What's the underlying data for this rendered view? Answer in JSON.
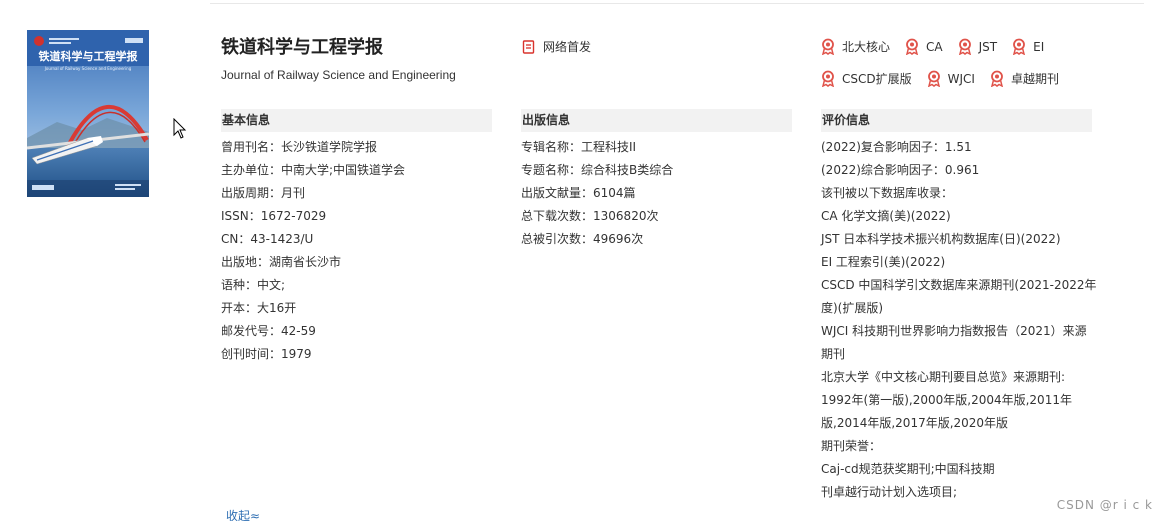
{
  "journal": {
    "title": "铁道科学与工程学报",
    "english_title": "Journal of Railway Science and Engineering",
    "network_first": "网络首发"
  },
  "badges_row1": [
    "北大核心",
    "CA",
    "JST",
    "EI"
  ],
  "badges_row2": [
    "CSCD扩展版",
    "WJCI",
    "卓越期刊"
  ],
  "basic": {
    "heading": "基本信息",
    "rows": [
      {
        "label": "曾用刊名：",
        "value": "长沙铁道学院学报"
      },
      {
        "label": "主办单位：",
        "value": "中南大学;中国铁道学会"
      },
      {
        "label": "出版周期：",
        "value": "月刊"
      },
      {
        "label": "ISSN：",
        "value": "1672-7029"
      },
      {
        "label": "CN：",
        "value": "43-1423/U"
      },
      {
        "label": "出版地：",
        "value": "湖南省长沙市"
      },
      {
        "label": "语种：",
        "value": "中文;"
      },
      {
        "label": "开本：",
        "value": "大16开"
      },
      {
        "label": "邮发代号：",
        "value": "42-59"
      },
      {
        "label": "创刊时间：",
        "value": "1979"
      }
    ]
  },
  "publish": {
    "heading": "出版信息",
    "rows": [
      {
        "label": "专辑名称：",
        "value": "工程科技II"
      },
      {
        "label": "专题名称：",
        "value": "综合科技B类综合"
      },
      {
        "label": "出版文献量：",
        "value": "6104篇"
      },
      {
        "label": "总下载次数：",
        "value": "1306820次"
      },
      {
        "label": "总被引次数：",
        "value": "49696次"
      }
    ]
  },
  "evaluation": {
    "heading": "评价信息",
    "lines": [
      "(2022)复合影响因子：1.51",
      "(2022)综合影响因子：0.961",
      "该刊被以下数据库收录：",
      "CA 化学文摘(美)(2022)",
      "JST 日本科学技术振兴机构数据库(日)(2022)",
      "EI 工程索引(美)(2022)",
      "CSCD 中国科学引文数据库来源期刊(2021-2022年",
      "度)(扩展版)",
      "WJCI 科技期刊世界影响力指数报告（2021）来源",
      "期刊",
      "北京大学《中文核心期刊要目总览》来源期刊:",
      "1992年(第一版),2000年版,2004年版,2011年",
      "版,2014年版,2017年版,2020年版",
      "期刊荣誉：",
      "Caj-cd规范获奖期刊;中国科技期",
      "刊卓越行动计划入选项目;"
    ]
  },
  "cover": {
    "title": "铁道科学与工程学报",
    "subtitle": "Journal of Railway Science and Engineering"
  },
  "collapse_label": "收起≈",
  "watermark": "CSDN @r i c k"
}
